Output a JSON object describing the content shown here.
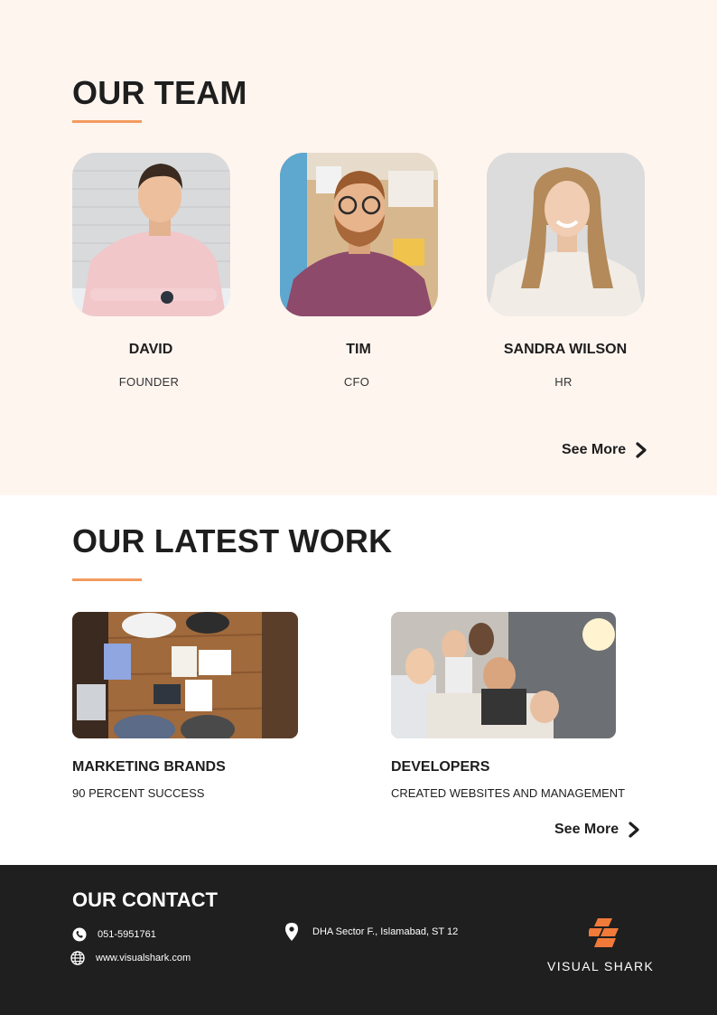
{
  "team": {
    "title": "OUR TEAM",
    "members": [
      {
        "name": "DAVID",
        "role": "FOUNDER"
      },
      {
        "name": "TIM",
        "role": "CFO"
      },
      {
        "name": "SANDRA WILSON",
        "role": "HR"
      }
    ],
    "see_more": "See More"
  },
  "work": {
    "title": "OUR LATEST WORK",
    "items": [
      {
        "title": "MARKETING BRANDS",
        "desc": "90 PERCENT SUCCESS"
      },
      {
        "title": "DEVELOPERS",
        "desc": "CREATED WEBSITES AND MANAGEMENT"
      }
    ],
    "see_more": "See More"
  },
  "contact": {
    "title": "OUR CONTACT",
    "phone": "051-5951761",
    "website": "www.visualshark.com",
    "address": "DHA Sector F., Islamabad, ST 12",
    "brand": "VISUAL SHARK"
  },
  "colors": {
    "accent": "#f29b5f",
    "team_bg": "#fff5ef",
    "footer_bg": "#1f1f1f",
    "logo": "#f07a3a"
  },
  "icons": [
    "chevron-right-icon",
    "phone-icon",
    "globe-icon",
    "location-pin-icon",
    "visual-shark-logo"
  ]
}
